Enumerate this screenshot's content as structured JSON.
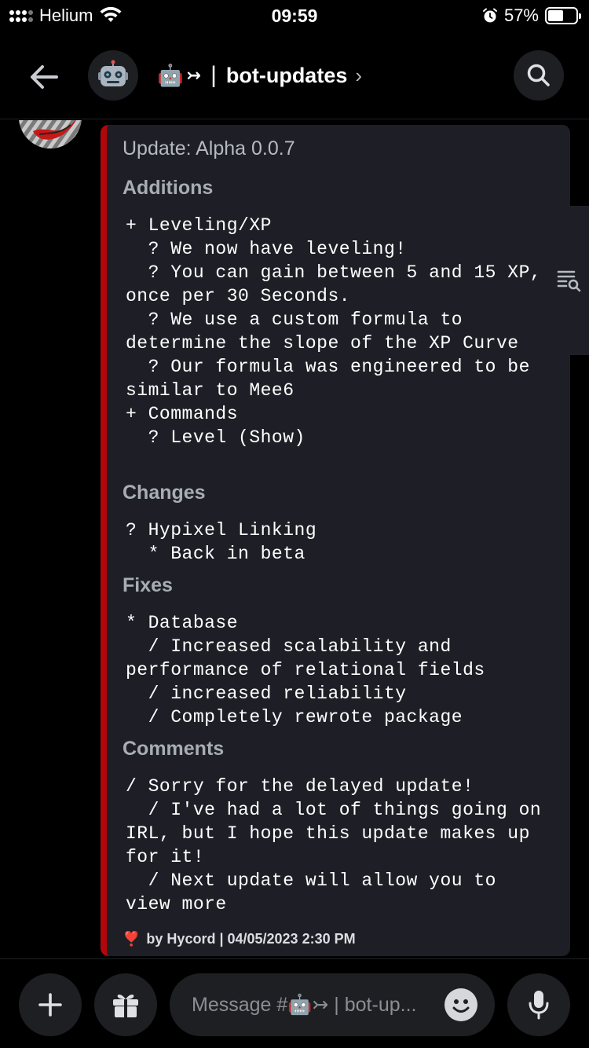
{
  "status_bar": {
    "carrier": "Helium",
    "time": "09:59",
    "battery_percent": "57%",
    "battery_level": 0.57
  },
  "header": {
    "channel_emoji": "🤖",
    "channel_arrow": "↣",
    "channel_separator": "|",
    "channel_name": "bot-updates",
    "chevron": "›"
  },
  "embed": {
    "accent_color": "#b1070b",
    "title": "Update: Alpha 0.0.7",
    "fields": [
      {
        "name": "Additions",
        "value": "+ Leveling/XP\n  ? We now have leveling!\n  ? You can gain between 5 and 15 XP, once per 30 Seconds.\n  ? We use a custom formula to determine the slope of the XP Curve\n  ? Our formula was engineered to be similar to Mee6\n+ Commands\n  ? Level (Show)"
      },
      {
        "name": "Changes",
        "value": "? Hypixel Linking\n  * Back in beta"
      },
      {
        "name": "Fixes",
        "value": "* Database\n  / Increased scalability and performance of relational fields\n  / increased reliability\n  / Completely rewrote package"
      },
      {
        "name": "Comments",
        "value": "/ Sorry for the delayed update!\n  / I've had a lot of things going on IRL, but I hope this update makes up for it!\n  / Next update will allow you to view more"
      }
    ],
    "footer_icon": "❣️",
    "footer_text": "by Hycord | 04/05/2023 2:30 PM"
  },
  "composer": {
    "placeholder": "Message #🤖↣ | bot-up..."
  },
  "icons": {
    "back": "arrow-left-icon",
    "search": "search-icon",
    "members_list": "list-search-icon",
    "add": "plus-icon",
    "gift": "gift-icon",
    "emoji": "smile-icon",
    "mic": "microphone-icon"
  }
}
